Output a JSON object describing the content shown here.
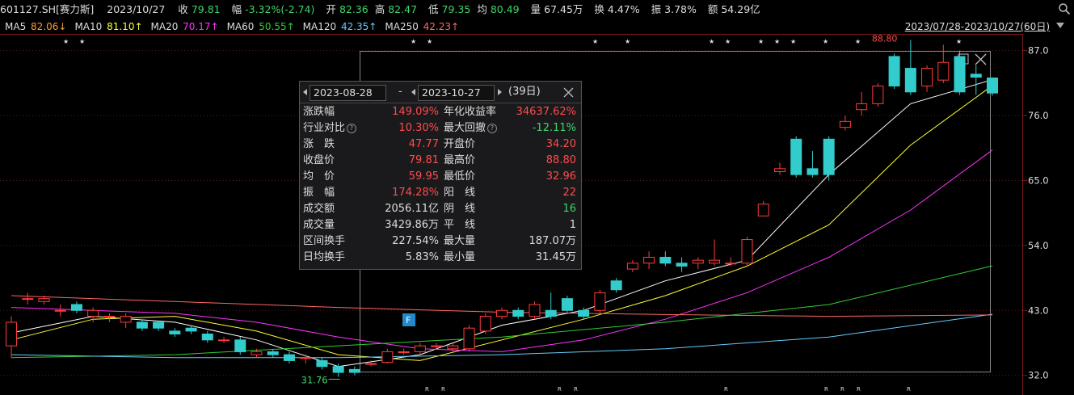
{
  "topbar": {
    "code": "601127.SH[赛力斯]",
    "date": "2023/10/27",
    "close_label": "收",
    "close": "79.81",
    "chg_label": "幅",
    "chg": "-3.32%(-2.74)",
    "open_label": "开",
    "open": "82.36",
    "high_label": "高",
    "high": "82.47",
    "low_label": "低",
    "low": "79.35",
    "avg_label": "均",
    "avg": "80.49",
    "vol_label": "量",
    "vol": "67.45万",
    "turn_label": "换",
    "turn": "4.47%",
    "amp_label": "振",
    "amp": "3.78%",
    "amt_label": "额",
    "amt": "54.29亿"
  },
  "ma_bar": [
    {
      "name": "MA5",
      "value": "82.06↓",
      "color": "#ffffff",
      "valcolor": "#ff9933"
    },
    {
      "name": "MA10",
      "value": "81.10↑",
      "color": "#ffffff",
      "valcolor": "#ffff33"
    },
    {
      "name": "MA20",
      "value": "70.17↑",
      "color": "#ffffff",
      "valcolor": "#ff33ff"
    },
    {
      "name": "MA60",
      "value": "50.55↑",
      "color": "#ffffff",
      "valcolor": "#33cc33"
    },
    {
      "name": "MA120",
      "value": "42.35↑",
      "color": "#ffffff",
      "valcolor": "#66ccff"
    },
    {
      "name": "MA250",
      "value": "42.23↑",
      "color": "#ffffff",
      "valcolor": "#ff6666"
    }
  ],
  "range_label": "2023/07/28-2023/10/27(60日)",
  "panel": {
    "start_date": "2023-08-28",
    "sep": "-",
    "end_date": "2023-10-27",
    "days": "(39日)",
    "rows": [
      {
        "l1": "涨跌幅",
        "v1": "149.09%",
        "c1": "up",
        "l2": "年化收益率",
        "v2": "34637.62%",
        "c2": "up"
      },
      {
        "l1": "行业对比",
        "help1": true,
        "v1": "10.30%",
        "c1": "up",
        "l2": "最大回撤",
        "help2": true,
        "v2": "-12.11%",
        "c2": "dn"
      },
      {
        "l1": "涨　跌",
        "v1": "47.77",
        "c1": "up",
        "l2": "开盘价",
        "v2": "34.20",
        "c2": "up"
      },
      {
        "l1": "收盘价",
        "v1": "79.81",
        "c1": "up",
        "l2": "最高价",
        "v2": "88.80",
        "c2": "up"
      },
      {
        "l1": "均　价",
        "v1": "59.95",
        "c1": "up",
        "l2": "最低价",
        "v2": "32.96",
        "c2": "up"
      },
      {
        "l1": "振　幅",
        "v1": "174.28%",
        "c1": "up",
        "l2": "阳　线",
        "v2": "22",
        "c2": "up"
      },
      {
        "l1": "成交额",
        "v1": "2056.11亿",
        "c1": "w",
        "l2": "阴　线",
        "v2": "16",
        "c2": "dn"
      },
      {
        "l1": "成交量",
        "v1": "3429.86万",
        "c1": "w",
        "l2": "平　线",
        "v2": "1",
        "c2": "w"
      },
      {
        "l1": "区间换手",
        "v1": "227.54%",
        "c1": "w",
        "l2": "最大量",
        "v2": "187.07万",
        "c2": "w"
      },
      {
        "l1": "日均换手",
        "v1": "5.83%",
        "c1": "w",
        "l2": "最小量",
        "v2": "31.45万",
        "c2": "w"
      }
    ]
  },
  "annotations": {
    "low_label": "31.76",
    "high_label": "88.80",
    "f_badge": "F",
    "r_mark": "R",
    "star": "★"
  },
  "colors": {
    "up": "#ff3b3b",
    "down": "#33cccc",
    "ma5": "#ffffff",
    "ma10": "#ffff33",
    "ma20": "#ff33ff",
    "ma60": "#33cc33",
    "ma120": "#66ccff",
    "ma250": "#ff6666",
    "grid": "#5a1a1a"
  },
  "chart_data": {
    "type": "candlestick",
    "y_ticks": [
      87.0,
      76.0,
      65.0,
      54.0,
      43.0,
      32.0
    ],
    "ylim": [
      31,
      89
    ],
    "candles": [
      [
        37,
        41,
        42,
        35
      ],
      [
        45,
        45,
        46,
        44
      ],
      [
        44.5,
        45,
        45.5,
        44
      ],
      [
        43,
        43,
        44,
        42
      ],
      [
        44,
        43,
        44.5,
        42.5
      ],
      [
        42,
        43,
        43.5,
        41
      ],
      [
        42,
        42,
        42.5,
        41
      ],
      [
        41,
        42,
        42.5,
        40
      ],
      [
        41,
        40,
        41.5,
        39.5
      ],
      [
        41,
        40,
        41,
        39.5
      ],
      [
        39.5,
        39,
        40,
        38.5
      ],
      [
        40,
        39.5,
        40.5,
        39
      ],
      [
        39,
        38,
        39.5,
        37.5
      ],
      [
        38,
        38,
        38.5,
        37.5
      ],
      [
        38,
        36,
        38.5,
        35.5
      ],
      [
        35.5,
        36,
        36.5,
        35
      ],
      [
        36,
        35.5,
        36.5,
        35
      ],
      [
        35.5,
        34.5,
        36,
        34
      ],
      [
        35,
        35,
        35.5,
        34
      ],
      [
        34.5,
        33.5,
        35,
        33
      ],
      [
        33.5,
        32.5,
        34,
        31.76
      ],
      [
        33,
        32.5,
        33.5,
        32
      ],
      [
        34,
        34,
        34.5,
        33.5
      ],
      [
        34.2,
        36,
        36.5,
        34
      ],
      [
        36,
        36,
        36.5,
        35.5
      ],
      [
        36,
        37,
        37.5,
        35.5
      ],
      [
        37,
        37,
        37.5,
        36.5
      ],
      [
        36.5,
        37,
        37.5,
        36
      ],
      [
        36.5,
        40,
        40.5,
        36
      ],
      [
        39.5,
        42,
        42.5,
        39
      ],
      [
        42,
        43,
        43.5,
        41.5
      ],
      [
        43,
        42,
        43.5,
        41.5
      ],
      [
        42,
        44,
        44.5,
        41.5
      ],
      [
        43,
        42,
        46,
        41.5
      ],
      [
        45,
        43,
        45.5,
        42.5
      ],
      [
        43,
        42,
        43.5,
        41.5
      ],
      [
        43,
        46,
        46.5,
        42.5
      ],
      [
        48,
        46.5,
        48.5,
        46
      ],
      [
        50,
        51,
        51.5,
        49.5
      ],
      [
        51,
        52,
        53,
        50
      ],
      [
        52,
        51,
        53,
        50.5
      ],
      [
        51,
        50.5,
        52,
        49.5
      ],
      [
        51,
        51.5,
        52,
        50
      ],
      [
        51,
        51.5,
        55,
        50.5
      ],
      [
        51,
        51,
        52,
        50.5
      ],
      [
        51,
        55,
        55.5,
        50.5
      ],
      [
        59,
        61,
        61.5,
        59
      ],
      [
        66.5,
        67,
        68,
        66
      ],
      [
        72,
        66,
        72.5,
        65.5
      ],
      [
        67,
        66,
        70,
        65.5
      ],
      [
        72,
        66,
        72.5,
        65
      ],
      [
        74,
        75,
        76,
        73.5
      ],
      [
        77,
        78,
        80,
        76
      ],
      [
        78,
        81,
        81.5,
        77.5
      ],
      [
        86,
        81,
        86.5,
        80.5
      ],
      [
        84,
        80,
        88.8,
        79.5
      ],
      [
        81,
        84,
        84.5,
        80
      ],
      [
        82,
        85,
        88,
        81.5
      ],
      [
        86,
        80,
        87,
        79.5
      ],
      [
        83,
        82.5,
        84.5,
        79.5
      ],
      [
        82.36,
        79.81,
        82.47,
        79.35
      ]
    ],
    "ma": {
      "MA5": [
        [
          0,
          39.2
        ],
        [
          5,
          42
        ],
        [
          10,
          41
        ],
        [
          15,
          38
        ],
        [
          20,
          33.5
        ],
        [
          25,
          35.5
        ],
        [
          30,
          40.5
        ],
        [
          35,
          43
        ],
        [
          40,
          48
        ],
        [
          45,
          51.5
        ],
        [
          50,
          66
        ],
        [
          55,
          78
        ],
        [
          60,
          82.06
        ]
      ],
      "MA10": [
        [
          0,
          38
        ],
        [
          5,
          41.5
        ],
        [
          10,
          42
        ],
        [
          15,
          39.5
        ],
        [
          20,
          35.5
        ],
        [
          25,
          34.5
        ],
        [
          30,
          38
        ],
        [
          35,
          41.5
        ],
        [
          40,
          45.5
        ],
        [
          45,
          50.5
        ],
        [
          50,
          57.5
        ],
        [
          55,
          71
        ],
        [
          60,
          81.1
        ]
      ],
      "MA20": [
        [
          0,
          43.5
        ],
        [
          5,
          43
        ],
        [
          10,
          42.5
        ],
        [
          15,
          41
        ],
        [
          20,
          38.5
        ],
        [
          25,
          36.5
        ],
        [
          30,
          36
        ],
        [
          35,
          38
        ],
        [
          40,
          41.5
        ],
        [
          45,
          46
        ],
        [
          50,
          52
        ],
        [
          55,
          60
        ],
        [
          60,
          70.17
        ]
      ],
      "MA60": [
        [
          0,
          35
        ],
        [
          10,
          35.5
        ],
        [
          20,
          37
        ],
        [
          30,
          38.5
        ],
        [
          40,
          41
        ],
        [
          50,
          44
        ],
        [
          60,
          50.55
        ]
      ],
      "MA120": [
        [
          0,
          35.5
        ],
        [
          10,
          35
        ],
        [
          20,
          35
        ],
        [
          30,
          35.5
        ],
        [
          40,
          36.5
        ],
        [
          50,
          38.5
        ],
        [
          60,
          42.35
        ]
      ],
      "MA250": [
        [
          0,
          45.5
        ],
        [
          10,
          44.5
        ],
        [
          20,
          43.5
        ],
        [
          30,
          42.7
        ],
        [
          40,
          42.3
        ],
        [
          50,
          42
        ],
        [
          60,
          42.23
        ]
      ]
    }
  }
}
